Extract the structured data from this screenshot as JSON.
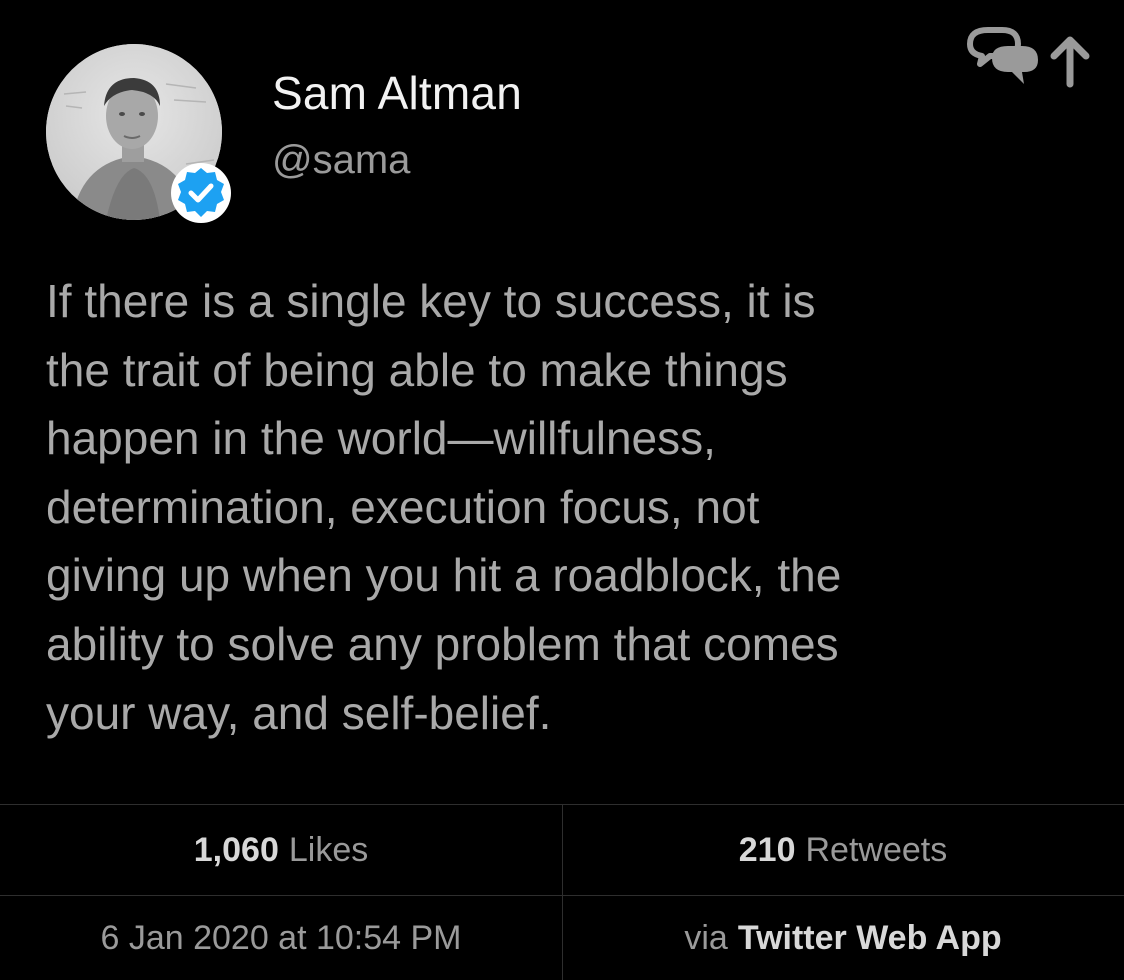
{
  "user": {
    "display_name": "Sam Altman",
    "handle": "@sama",
    "verified": true,
    "verified_color": "#1da1f2"
  },
  "tweet": {
    "lines": [
      "If there is a single key to success, it is",
      "the trait of being able to make things",
      "happen in the world—willfulness,",
      "determination, execution focus, not",
      "giving up when you hit a roadblock, the",
      "ability to solve any problem that comes",
      "your way, and self-belief."
    ]
  },
  "stats": {
    "likes_count": "1,060",
    "likes_label": "Likes",
    "retweets_count": "210",
    "retweets_label": "Retweets"
  },
  "meta": {
    "timestamp": "6 Jan 2020 at 10:54 PM",
    "via_label": "via",
    "source": "Twitter Web App"
  },
  "icons": {
    "share": "speech-bubbles-up-arrow-icon",
    "verified": "verified-badge-icon"
  },
  "colors": {
    "background": "#000000",
    "text_primary": "#f2f2f2",
    "text_secondary": "#9a9a9a",
    "tweet_text": "#a9a9a9"
  }
}
